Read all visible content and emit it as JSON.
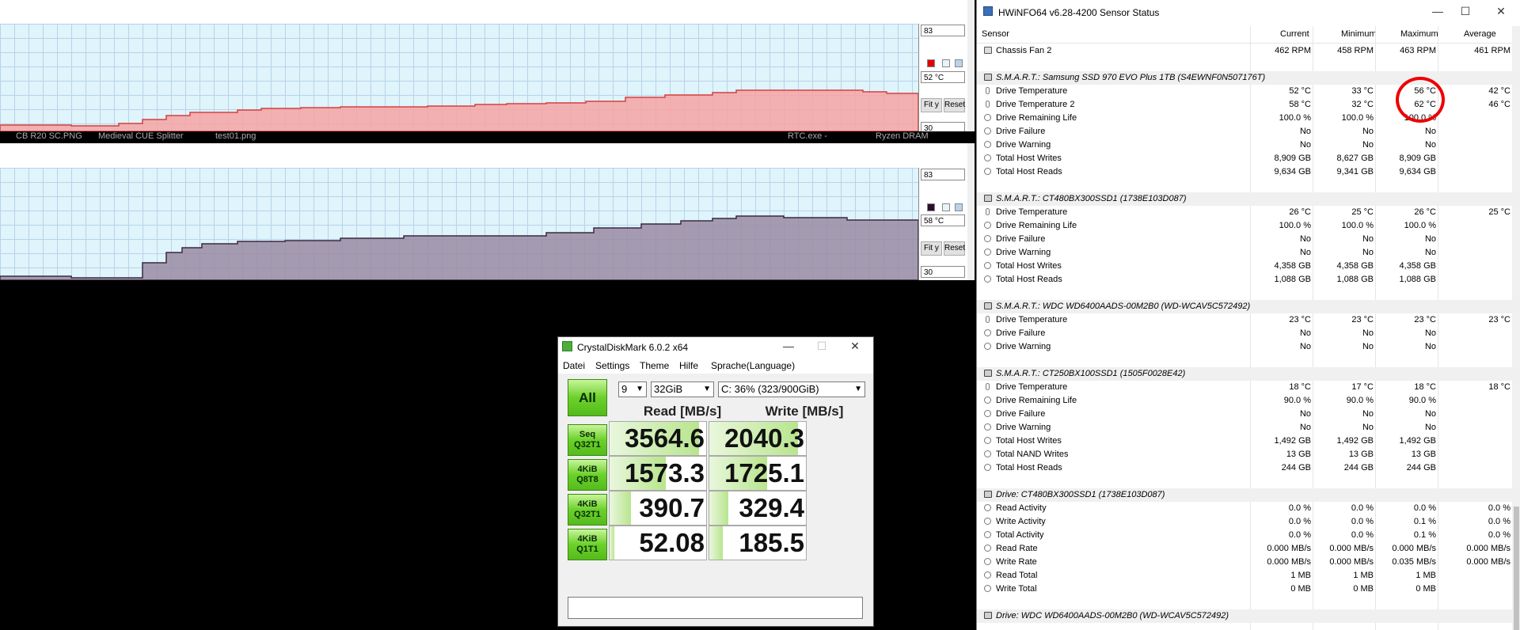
{
  "graph1": {
    "field_max": "83",
    "field_value": "52 °C",
    "field_min": "30",
    "fit_label": "Fit y",
    "reset_label": "Reset",
    "swatch_color": "#e00000",
    "fill_color": "#f6a3a3",
    "line_color": "#d44040"
  },
  "graph2": {
    "field_max": "83",
    "field_value": "58 °C",
    "field_min": "30",
    "fit_label": "Fit y",
    "reset_label": "Reset",
    "swatch_color": "#2a0f2a",
    "fill_color": "#9a8ba3",
    "line_color": "#3a2a40"
  },
  "taskbar_strip": [
    "CB R20 SC.PNG",
    "Medieval CUE Splitter",
    "test01.png",
    "RTC.exe -",
    "Ryzen DRAM"
  ],
  "hwinfo": {
    "title": "HWiNFO64 v6.28-4200 Sensor Status",
    "columns": {
      "sensor": "Sensor",
      "current": "Current",
      "minimum": "Minimum",
      "maximum": "Maximum",
      "average": "Average"
    },
    "rows": [
      {
        "kind": "fan",
        "label": "Chassis Fan 2",
        "cur": "462 RPM",
        "min": "458 RPM",
        "max": "463 RPM",
        "avg": "461 RPM"
      },
      {
        "kind": "gap"
      },
      {
        "kind": "group",
        "label": "S.M.A.R.T.: Samsung SSD 970 EVO Plus 1TB (S4EWNF0N507176T)"
      },
      {
        "kind": "temp",
        "label": "Drive Temperature",
        "cur": "52 °C",
        "min": "33 °C",
        "max": "56 °C",
        "avg": "42 °C"
      },
      {
        "kind": "temp",
        "label": "Drive Temperature 2",
        "cur": "58 °C",
        "min": "32 °C",
        "max": "62 °C",
        "avg": "46 °C"
      },
      {
        "kind": "circ",
        "label": "Drive Remaining Life",
        "cur": "100.0 %",
        "min": "100.0 %",
        "max": "100.0 %",
        "avg": ""
      },
      {
        "kind": "circ",
        "label": "Drive Failure",
        "cur": "No",
        "min": "No",
        "max": "No",
        "avg": ""
      },
      {
        "kind": "circ",
        "label": "Drive Warning",
        "cur": "No",
        "min": "No",
        "max": "No",
        "avg": ""
      },
      {
        "kind": "circ",
        "label": "Total Host Writes",
        "cur": "8,909 GB",
        "min": "8,627 GB",
        "max": "8,909 GB",
        "avg": ""
      },
      {
        "kind": "circ",
        "label": "Total Host Reads",
        "cur": "9,634 GB",
        "min": "9,341 GB",
        "max": "9,634 GB",
        "avg": ""
      },
      {
        "kind": "gap"
      },
      {
        "kind": "group",
        "label": "S.M.A.R.T.: CT480BX300SSD1 (1738E103D087)"
      },
      {
        "kind": "temp",
        "label": "Drive Temperature",
        "cur": "26 °C",
        "min": "25 °C",
        "max": "26 °C",
        "avg": "25 °C"
      },
      {
        "kind": "circ",
        "label": "Drive Remaining Life",
        "cur": "100.0 %",
        "min": "100.0 %",
        "max": "100.0 %",
        "avg": ""
      },
      {
        "kind": "circ",
        "label": "Drive Failure",
        "cur": "No",
        "min": "No",
        "max": "No",
        "avg": ""
      },
      {
        "kind": "circ",
        "label": "Drive Warning",
        "cur": "No",
        "min": "No",
        "max": "No",
        "avg": ""
      },
      {
        "kind": "circ",
        "label": "Total Host Writes",
        "cur": "4,358 GB",
        "min": "4,358 GB",
        "max": "4,358 GB",
        "avg": ""
      },
      {
        "kind": "circ",
        "label": "Total Host Reads",
        "cur": "1,088 GB",
        "min": "1,088 GB",
        "max": "1,088 GB",
        "avg": ""
      },
      {
        "kind": "gap"
      },
      {
        "kind": "group",
        "label": "S.M.A.R.T.: WDC WD6400AADS-00M2B0 (WD-WCAV5C572492)"
      },
      {
        "kind": "temp",
        "label": "Drive Temperature",
        "cur": "23 °C",
        "min": "23 °C",
        "max": "23 °C",
        "avg": "23 °C"
      },
      {
        "kind": "circ",
        "label": "Drive Failure",
        "cur": "No",
        "min": "No",
        "max": "No",
        "avg": ""
      },
      {
        "kind": "circ",
        "label": "Drive Warning",
        "cur": "No",
        "min": "No",
        "max": "No",
        "avg": ""
      },
      {
        "kind": "gap"
      },
      {
        "kind": "group",
        "label": "S.M.A.R.T.: CT250BX100SSD1 (1505F0028E42)"
      },
      {
        "kind": "temp",
        "label": "Drive Temperature",
        "cur": "18 °C",
        "min": "17 °C",
        "max": "18 °C",
        "avg": "18 °C"
      },
      {
        "kind": "circ",
        "label": "Drive Remaining Life",
        "cur": "90.0 %",
        "min": "90.0 %",
        "max": "90.0 %",
        "avg": ""
      },
      {
        "kind": "circ",
        "label": "Drive Failure",
        "cur": "No",
        "min": "No",
        "max": "No",
        "avg": ""
      },
      {
        "kind": "circ",
        "label": "Drive Warning",
        "cur": "No",
        "min": "No",
        "max": "No",
        "avg": ""
      },
      {
        "kind": "circ",
        "label": "Total Host Writes",
        "cur": "1,492 GB",
        "min": "1,492 GB",
        "max": "1,492 GB",
        "avg": ""
      },
      {
        "kind": "circ",
        "label": "Total NAND Writes",
        "cur": "13 GB",
        "min": "13 GB",
        "max": "13 GB",
        "avg": ""
      },
      {
        "kind": "circ",
        "label": "Total Host Reads",
        "cur": "244 GB",
        "min": "244 GB",
        "max": "244 GB",
        "avg": ""
      },
      {
        "kind": "gap"
      },
      {
        "kind": "group",
        "label": "Drive: CT480BX300SSD1 (1738E103D087)"
      },
      {
        "kind": "circ",
        "label": "Read Activity",
        "cur": "0.0 %",
        "min": "0.0 %",
        "max": "0.0 %",
        "avg": "0.0 %"
      },
      {
        "kind": "circ",
        "label": "Write Activity",
        "cur": "0.0 %",
        "min": "0.0 %",
        "max": "0.1 %",
        "avg": "0.0 %"
      },
      {
        "kind": "circ",
        "label": "Total Activity",
        "cur": "0.0 %",
        "min": "0.0 %",
        "max": "0.1 %",
        "avg": "0.0 %"
      },
      {
        "kind": "circ",
        "label": "Read Rate",
        "cur": "0.000 MB/s",
        "min": "0.000 MB/s",
        "max": "0.000 MB/s",
        "avg": "0.000 MB/s"
      },
      {
        "kind": "circ",
        "label": "Write Rate",
        "cur": "0.000 MB/s",
        "min": "0.000 MB/s",
        "max": "0.035 MB/s",
        "avg": "0.000 MB/s"
      },
      {
        "kind": "circ",
        "label": "Read Total",
        "cur": "1 MB",
        "min": "1 MB",
        "max": "1 MB",
        "avg": ""
      },
      {
        "kind": "circ",
        "label": "Write Total",
        "cur": "0 MB",
        "min": "0 MB",
        "max": "0 MB",
        "avg": ""
      },
      {
        "kind": "gap"
      },
      {
        "kind": "group",
        "label": "Drive: WDC WD6400AADS-00M2B0 (WD-WCAV5C572492)"
      }
    ]
  },
  "cdm": {
    "title": "CrystalDiskMark 6.0.2 x64",
    "menu": [
      "Datei",
      "Settings",
      "Theme",
      "Hilfe",
      "Sprache(Language)"
    ],
    "all_label": "All",
    "count": "9",
    "size": "32GiB",
    "drive": "C: 36% (323/900GiB)",
    "read_header": "Read [MB/s]",
    "write_header": "Write [MB/s]",
    "tests": [
      {
        "l1": "Seq",
        "l2": "Q32T1",
        "read": "3564.6",
        "write": "2040.3",
        "rfill": 0.93,
        "wfill": 0.92
      },
      {
        "l1": "4KiB",
        "l2": "Q8T8",
        "read": "1573.3",
        "write": "1725.1",
        "rfill": 0.58,
        "wfill": 0.6
      },
      {
        "l1": "4KiB",
        "l2": "Q32T1",
        "read": "390.7",
        "write": "329.4",
        "rfill": 0.22,
        "wfill": 0.2
      },
      {
        "l1": "4KiB",
        "l2": "Q1T1",
        "read": "52.08",
        "write": "185.5",
        "rfill": 0.05,
        "wfill": 0.14
      }
    ]
  }
}
